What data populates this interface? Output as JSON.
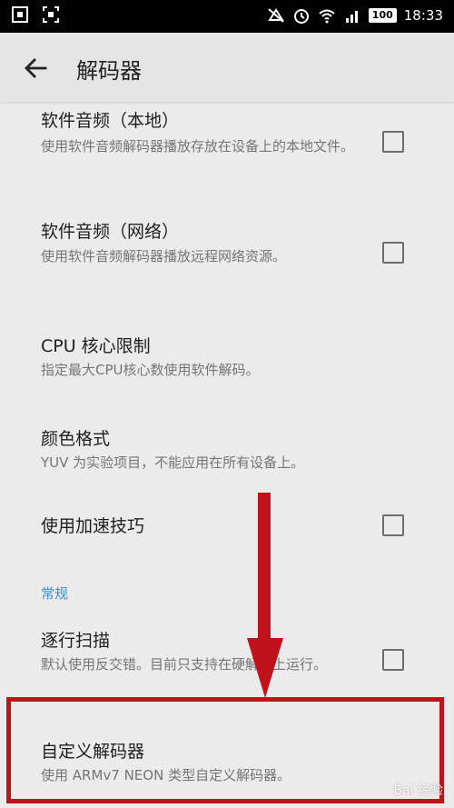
{
  "status_bar": {
    "time": "18:33",
    "battery": "100"
  },
  "app_bar": {
    "title": "解码器"
  },
  "items": [
    {
      "title": "软件音频（本地）",
      "summary": "使用软件音频解码器播放存放在设备上的本地文件。",
      "checked": false
    },
    {
      "title": "软件音频（网络）",
      "summary": "使用软件音频解码器播放远程网络资源。",
      "checked": false
    },
    {
      "title": "CPU 核心限制",
      "summary": "指定最大CPU核心数使用软件解码。"
    },
    {
      "title": "颜色格式",
      "summary": "YUV 为实验项目，不能应用在所有设备上。"
    },
    {
      "title": "使用加速技巧",
      "checked": false
    },
    {
      "title": "逐行扫描",
      "summary": "默认使用反交错。目前只支持在硬解码上运行。",
      "checked": false
    },
    {
      "title": "自定义解码器",
      "summary": "使用 ARMv7 NEON 类型自定义解码器。"
    }
  ],
  "section_header": "常规",
  "watermark": "Bai 经验",
  "colors": {
    "accent": "#3d8fd1",
    "highlight": "#c0121a"
  }
}
